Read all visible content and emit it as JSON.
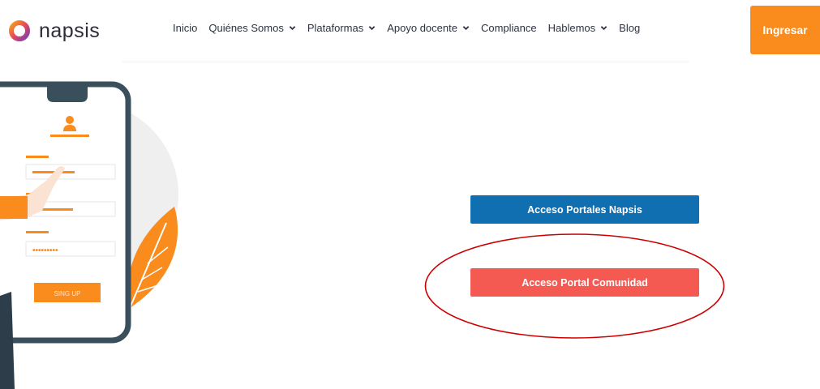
{
  "brand": {
    "name": "napsis"
  },
  "nav": {
    "items": [
      {
        "label": "Inicio",
        "has_dropdown": false
      },
      {
        "label": "Quiénes Somos",
        "has_dropdown": true
      },
      {
        "label": "Plataformas",
        "has_dropdown": true
      },
      {
        "label": "Apoyo docente",
        "has_dropdown": true
      },
      {
        "label": "Compliance",
        "has_dropdown": false
      },
      {
        "label": "Hablemos",
        "has_dropdown": true
      },
      {
        "label": "Blog",
        "has_dropdown": false
      }
    ],
    "cta_label": "Ingresar"
  },
  "illustration": {
    "signup_label": "SING UP",
    "password_mask": "•••••••••"
  },
  "main": {
    "napsis_button_label": "Acceso Portales Napsis",
    "community_button_label": "Acceso Portal Comunidad"
  },
  "colors": {
    "accent_orange": "#f98c1d",
    "napsis_blue": "#106fb0",
    "community_red": "#f55a52",
    "highlight_ring": "#cc0000"
  }
}
